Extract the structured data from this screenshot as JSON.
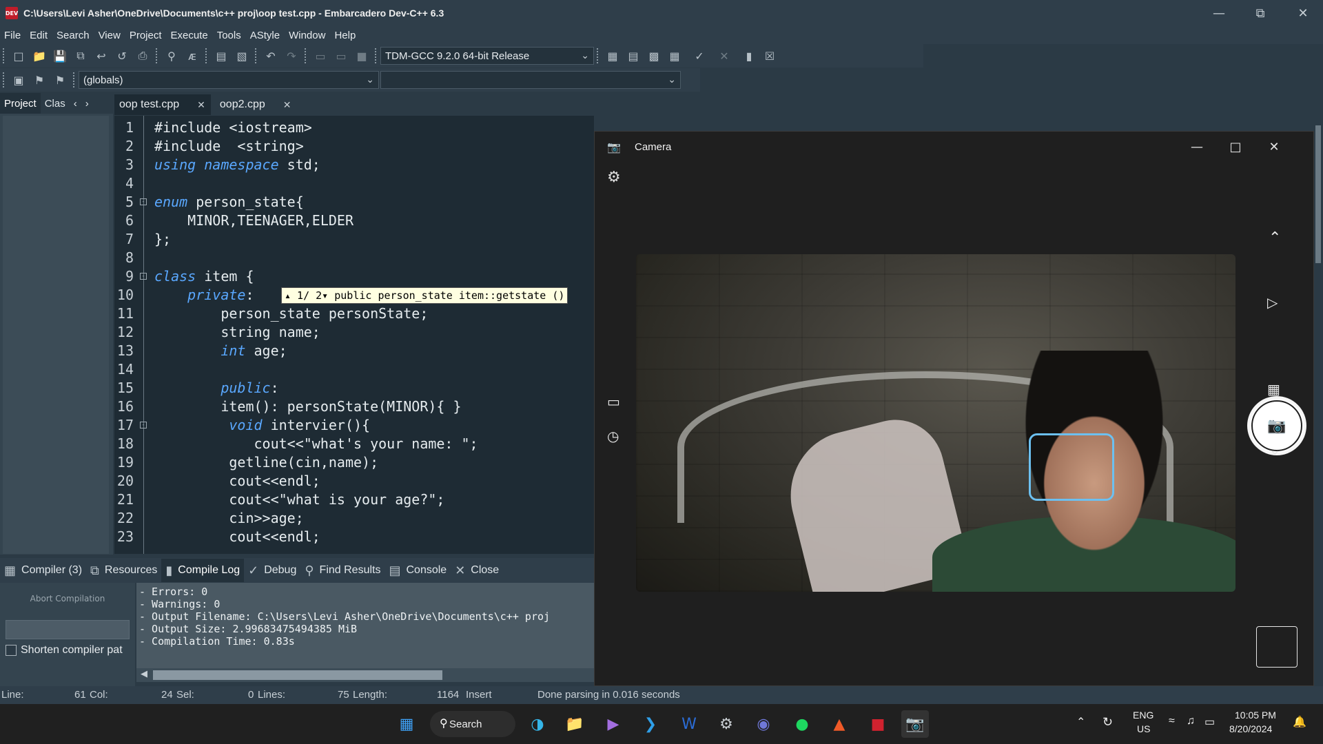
{
  "titlebar": {
    "app_icon": "DEV",
    "title": "C:\\Users\\Levi Asher\\OneDrive\\Documents\\c++ proj\\oop test.cpp - Embarcadero Dev-C++ 6.3"
  },
  "menu": [
    "File",
    "Edit",
    "Search",
    "View",
    "Project",
    "Execute",
    "Tools",
    "AStyle",
    "Window",
    "Help"
  ],
  "toolbar": {
    "compiler_select": "TDM-GCC 9.2.0 64-bit Release",
    "scope_select": "(globals)",
    "member_select": ""
  },
  "left_tabs": [
    "Project",
    "Clas"
  ],
  "editor_tabs": [
    {
      "label": "oop test.cpp",
      "active": true
    },
    {
      "label": "oop2.cpp",
      "active": false
    }
  ],
  "code_lines": [
    {
      "n": "1",
      "text": "#include <iostream>"
    },
    {
      "n": "2",
      "text": "#include  <string>"
    },
    {
      "n": "3",
      "text": "using namespace std;"
    },
    {
      "n": "4",
      "text": ""
    },
    {
      "n": "5",
      "text": "enum person_state{"
    },
    {
      "n": "6",
      "text": "    MINOR,TEENAGER,ELDER"
    },
    {
      "n": "7",
      "text": "};"
    },
    {
      "n": "8",
      "text": ""
    },
    {
      "n": "9",
      "text": "class item {"
    },
    {
      "n": "10",
      "text": "    private:"
    },
    {
      "n": "11",
      "text": "        person_state personState;"
    },
    {
      "n": "12",
      "text": "        string name;"
    },
    {
      "n": "13",
      "text": "        int age;"
    },
    {
      "n": "14",
      "text": ""
    },
    {
      "n": "15",
      "text": "        public:"
    },
    {
      "n": "16",
      "text": "        item(): personState(MINOR){ }"
    },
    {
      "n": "17",
      "text": "         void intervier(){"
    },
    {
      "n": "18",
      "text": "            cout<<\"what's your name: \";"
    },
    {
      "n": "19",
      "text": "         getline(cin,name);"
    },
    {
      "n": "20",
      "text": "         cout<<endl;"
    },
    {
      "n": "21",
      "text": "         cout<<\"what is your age?\";"
    },
    {
      "n": "22",
      "text": "         cin>>age;"
    },
    {
      "n": "23",
      "text": "         cout<<endl;"
    }
  ],
  "tooltip": "▴ 1/ 2▾ public person_state item::getstate ()",
  "bottom_tabs": [
    {
      "label": "Compiler (3)",
      "icon": "grid-icon"
    },
    {
      "label": "Resources",
      "icon": "resources-icon"
    },
    {
      "label": "Compile Log",
      "icon": "chart-icon",
      "active": true
    },
    {
      "label": "Debug",
      "icon": "check-icon"
    },
    {
      "label": "Find Results",
      "icon": "find-icon"
    },
    {
      "label": "Console",
      "icon": "console-icon"
    },
    {
      "label": "Close",
      "icon": "close-icon"
    }
  ],
  "abort_label": "Abort Compilation",
  "shorten_label": "Shorten compiler pat",
  "compile_log": [
    "- Errors: 0",
    "- Warnings: 0",
    "- Output Filename: C:\\Users\\Levi Asher\\OneDrive\\Documents\\c++ proj",
    "- Output Size: 2.99683475494385 MiB",
    "- Compilation Time: 0.83s"
  ],
  "status": {
    "line_label": "Line:",
    "line_val": "61",
    "col_label": "Col:",
    "col_val": "24",
    "sel_label": "Sel:",
    "sel_val": "0",
    "lines_label": "Lines:",
    "lines_val": "75",
    "length_label": "Length:",
    "length_val": "1164",
    "mode": "Insert",
    "message": "Done parsing in 0.016 seconds"
  },
  "camera": {
    "title": "Camera",
    "accent": "#6cc0f0"
  },
  "taskbar": {
    "search_label": "Search",
    "lang_top": "ENG",
    "lang_bottom": "US",
    "time": "10:05 PM",
    "date": "8/20/2024"
  }
}
